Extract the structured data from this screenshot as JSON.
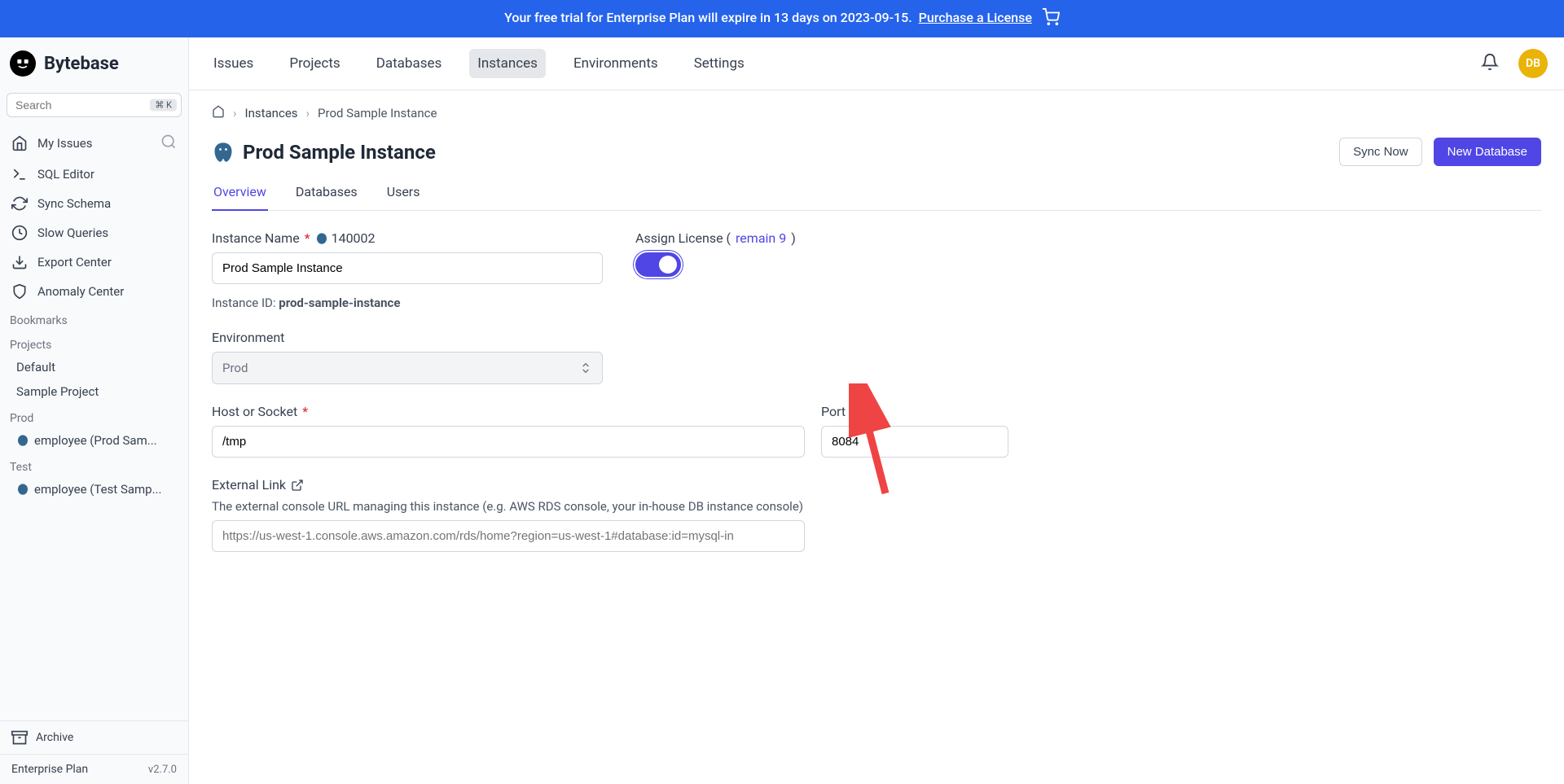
{
  "banner": {
    "text_before": "Your free trial for Enterprise Plan will expire in 13 days on 2023-09-15.",
    "link": "Purchase a License"
  },
  "logo": "Bytebase",
  "search": {
    "placeholder": "Search",
    "kbd": "⌘ K"
  },
  "sidebar": {
    "items": [
      {
        "label": "My Issues"
      },
      {
        "label": "SQL Editor"
      },
      {
        "label": "Sync Schema"
      },
      {
        "label": "Slow Queries"
      },
      {
        "label": "Export Center"
      },
      {
        "label": "Anomaly Center"
      }
    ],
    "bookmarks_label": "Bookmarks",
    "projects_label": "Projects",
    "projects": [
      "Default",
      "Sample Project"
    ],
    "envs": [
      {
        "name": "Prod",
        "db": "employee (Prod Sam..."
      },
      {
        "name": "Test",
        "db": "employee (Test Samp..."
      }
    ],
    "archive": "Archive",
    "plan": "Enterprise Plan",
    "version": "v2.7.0"
  },
  "topnav": [
    "Issues",
    "Projects",
    "Databases",
    "Instances",
    "Environments",
    "Settings"
  ],
  "avatar": "DB",
  "breadcrumb": {
    "instances": "Instances",
    "current": "Prod Sample Instance"
  },
  "page": {
    "title": "Prod Sample Instance",
    "sync_btn": "Sync Now",
    "new_db_btn": "New Database"
  },
  "tabs": [
    "Overview",
    "Databases",
    "Users"
  ],
  "form": {
    "instance_name_label": "Instance Name",
    "instance_badge": "140002",
    "instance_name_value": "Prod Sample Instance",
    "instance_id_label": "Instance ID: ",
    "instance_id_value": "prod-sample-instance",
    "license_label": "Assign License (",
    "license_remain": "remain 9",
    "license_close": ")",
    "env_label": "Environment",
    "env_value": "Prod",
    "host_label": "Host or Socket",
    "host_value": "/tmp",
    "port_label": "Port",
    "port_value": "8084",
    "ext_link_label": "External Link",
    "ext_link_help": "The external console URL managing this instance (e.g. AWS RDS console, your in-house DB instance console)",
    "ext_link_placeholder": "https://us-west-1.console.aws.amazon.com/rds/home?region=us-west-1#database:id=mysql-in"
  }
}
